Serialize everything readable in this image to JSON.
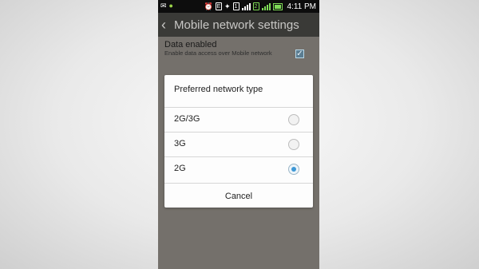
{
  "statusbar": {
    "time": "4:11 PM",
    "network_badge": "E",
    "sim_badge": "1",
    "sim2_badge": "2",
    "notif_glyph": "✉"
  },
  "actionbar": {
    "back_glyph": "‹",
    "title": "Mobile network settings"
  },
  "setting": {
    "title": "Data enabled",
    "subtitle": "Enable data access over Mobile network",
    "checked": true
  },
  "dialog": {
    "title": "Preferred network type",
    "options": [
      {
        "label": "2G/3G",
        "selected": false
      },
      {
        "label": "3G",
        "selected": false
      },
      {
        "label": "2G",
        "selected": true
      }
    ],
    "cancel_label": "Cancel"
  },
  "colors": {
    "accent": "#3e98d6",
    "signal_green": "#7ed957",
    "dim_background": "#74706b"
  },
  "icons": [
    "notification-icon",
    "android-icon",
    "alarm-icon",
    "network-type-icon",
    "sim1-icon",
    "signal-icon",
    "sim2-icon",
    "signal-icon",
    "battery-icon"
  ]
}
